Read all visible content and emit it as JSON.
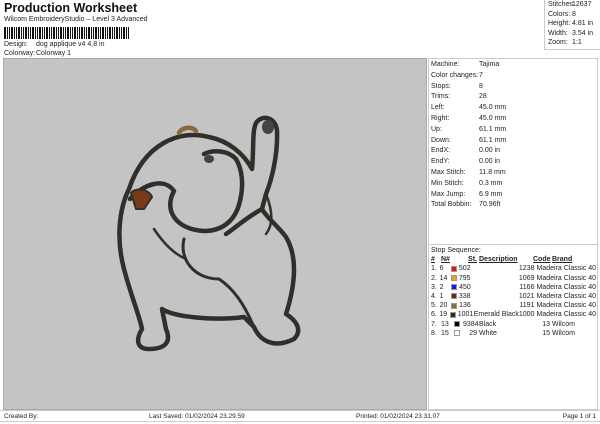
{
  "header": {
    "title": "Production Worksheet",
    "subtitle": "Wilcom EmbroideryStudio – Level 3 Advanced",
    "design_label": "Design:",
    "design_value": "dog applique v4 4,8 in",
    "colorway_label": "Colorway:",
    "colorway_value": "Colorway 1"
  },
  "summary": [
    {
      "label": "Stitches:",
      "value": "12637"
    },
    {
      "label": "Colors:",
      "value": "8"
    },
    {
      "label": "Height:",
      "value": "4.81 in"
    },
    {
      "label": "Width:",
      "value": "3.54 in"
    },
    {
      "label": "Zoom:",
      "value": "1:1"
    }
  ],
  "properties": [
    {
      "label": "Machine:",
      "value": "Tajima"
    },
    {
      "label": "Color changes:",
      "value": "7"
    },
    {
      "label": "Stops:",
      "value": "8"
    },
    {
      "label": "Trims:",
      "value": "28"
    },
    {
      "label": "Left:",
      "value": "45.0 mm"
    },
    {
      "label": "Right:",
      "value": "45.0 mm"
    },
    {
      "label": "Up:",
      "value": "61.1 mm"
    },
    {
      "label": "Down:",
      "value": "61.1 mm"
    },
    {
      "label": "EndX:",
      "value": "0.00 in"
    },
    {
      "label": "EndY:",
      "value": "0.00 in"
    },
    {
      "label": "Max Stitch:",
      "value": "11.8 mm"
    },
    {
      "label": "Min Stitch:",
      "value": "0.3 mm"
    },
    {
      "label": "Max Jump:",
      "value": "6.9 mm"
    },
    {
      "label": "Total Bobbin:",
      "value": "70.96ft"
    }
  ],
  "stops": {
    "title": "Stop Sequence:",
    "headers": [
      "#",
      "N#",
      "St.",
      "Description",
      "Code",
      "Brand"
    ],
    "rows": [
      {
        "n": "1.",
        "needle": "6",
        "color": "#ee1111",
        "st": "502",
        "desc": "",
        "code": "1238",
        "brand": "Madeira Classic 40"
      },
      {
        "n": "2.",
        "needle": "14",
        "color": "#f5a000",
        "st": "795",
        "desc": "",
        "code": "1069",
        "brand": "Madeira Classic 40"
      },
      {
        "n": "3.",
        "needle": "2",
        "color": "#0a1ee6",
        "st": "450",
        "desc": "",
        "code": "1166",
        "brand": "Madeira Classic 40"
      },
      {
        "n": "4.",
        "needle": "1",
        "color": "#6b2a12",
        "st": "338",
        "desc": "",
        "code": "1021",
        "brand": "Madeira Classic 40"
      },
      {
        "n": "5.",
        "needle": "20",
        "color": "#8a6a3a",
        "st": "136",
        "desc": "",
        "code": "1191",
        "brand": "Madeira Classic 40"
      },
      {
        "n": "6.",
        "needle": "19",
        "color": "#2b2b22",
        "st": "1001",
        "desc": "Emerald Black",
        "code": "1000",
        "brand": "Madeira Classic 40"
      },
      {
        "n": "7.",
        "needle": "13",
        "color": "#000000",
        "st": "9384",
        "desc": "Black",
        "code": "13",
        "brand": "Wilcom"
      },
      {
        "n": "8.",
        "needle": "15",
        "color": "#ffffff",
        "st": "29",
        "desc": "White",
        "code": "15",
        "brand": "Wilcom"
      }
    ]
  },
  "footer": {
    "created": "Created By:",
    "saved": "Last Saved: 01/02/2024 23.29.59",
    "printed": "Printed: 01/02/2024 23.31.07",
    "page": "Page 1 of 1"
  }
}
